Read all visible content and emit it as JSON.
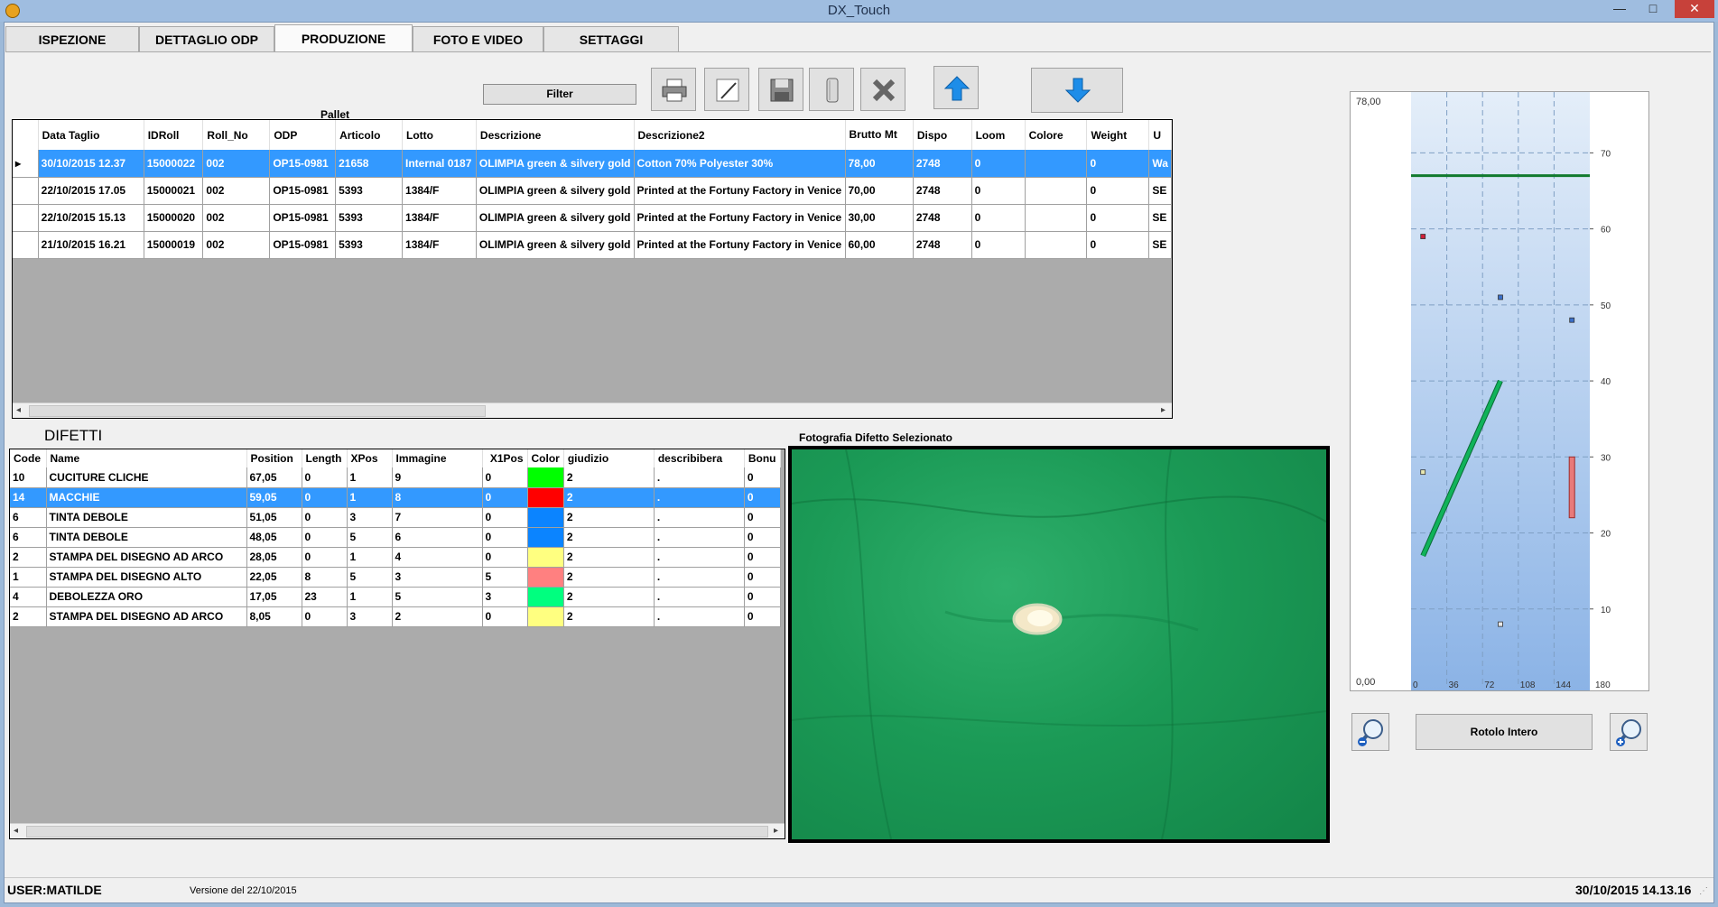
{
  "window": {
    "title": "DX_Touch",
    "close_glyph": "✕",
    "max_glyph": "□",
    "min_glyph": "—"
  },
  "tabs": [
    {
      "label": "ISPEZIONE"
    },
    {
      "label": "DETTAGLIO ODP"
    },
    {
      "label": "PRODUZIONE",
      "active": true
    },
    {
      "label": "FOTO E VIDEO"
    },
    {
      "label": "SETTAGGI"
    }
  ],
  "toolbar": {
    "filter_label": "Filter",
    "icons": [
      "printer-icon",
      "edit-icon",
      "save-icon",
      "roll-icon",
      "delete-icon",
      "arrow-up-icon",
      "arrow-down-icon"
    ]
  },
  "rolls": {
    "group_header": "Pallet",
    "columns": [
      "Data Taglio",
      "IDRoll",
      "Roll_No",
      "ODP",
      "Articolo",
      "Lotto",
      "Descrizione",
      "Descrizione2",
      "Brutto Mt",
      "Dispo",
      "Loom",
      "Colore",
      "Weight",
      "U"
    ],
    "rows": [
      [
        "30/10/2015 12.37",
        "15000022",
        "002",
        "OP15-0981",
        "21658",
        "Internal 0187",
        "OLIMPIA green & silvery gold",
        "Cotton 70% Polyester 30%",
        "78,00",
        "2748",
        "0",
        "",
        "0",
        "Wa"
      ],
      [
        "22/10/2015 17.05",
        "15000021",
        "002",
        "OP15-0981",
        "5393",
        "1384/F",
        "OLIMPIA green & silvery gold",
        "Printed at the Fortuny Factory in Venice",
        "70,00",
        "2748",
        "0",
        "",
        "0",
        "SE"
      ],
      [
        "22/10/2015 15.13",
        "15000020",
        "002",
        "OP15-0981",
        "5393",
        "1384/F",
        "OLIMPIA green & silvery gold",
        "Printed at the Fortuny Factory in Venice",
        "30,00",
        "2748",
        "0",
        "",
        "0",
        "SE"
      ],
      [
        "21/10/2015 16.21",
        "15000019",
        "002",
        "OP15-0981",
        "5393",
        "1384/F",
        "OLIMPIA green & silvery gold",
        "Printed at the Fortuny Factory in Venice",
        "60,00",
        "2748",
        "0",
        "",
        "0",
        "SE"
      ]
    ],
    "selected_index": 0,
    "row_marker": "▸"
  },
  "defects": {
    "title": "DIFETTI",
    "columns": [
      "Code",
      "Name",
      "Position",
      "Length",
      "XPos",
      "Immagine",
      "X1Pos",
      "Color",
      "giudizio",
      "describibera",
      "Bonu"
    ],
    "rows": [
      [
        "10",
        "CUCITURE CLICHE",
        "67,05",
        "0",
        "1",
        "9",
        "0",
        "#00ff00",
        "2",
        ".",
        "0"
      ],
      [
        "14",
        "MACCHIE",
        "59,05",
        "0",
        "1",
        "8",
        "0",
        "#ff0000",
        "2",
        ".",
        "0"
      ],
      [
        "6",
        "TINTA DEBOLE",
        "51,05",
        "0",
        "3",
        "7",
        "0",
        "#0b84ff",
        "2",
        ".",
        "0"
      ],
      [
        "6",
        "TINTA DEBOLE",
        "48,05",
        "0",
        "5",
        "6",
        "0",
        "#0b84ff",
        "2",
        ".",
        "0"
      ],
      [
        "2",
        "STAMPA DEL DISEGNO AD ARCO",
        "28,05",
        "0",
        "1",
        "4",
        "0",
        "#ffff80",
        "2",
        ".",
        "0"
      ],
      [
        "1",
        "STAMPA DEL DISEGNO ALTO",
        "22,05",
        "8",
        "5",
        "3",
        "5",
        "#ff8080",
        "2",
        ".",
        "0"
      ],
      [
        "4",
        "DEBOLEZZA ORO",
        "17,05",
        "23",
        "1",
        "5",
        "3",
        "#00ff7f",
        "2",
        ".",
        "0"
      ],
      [
        "2",
        "STAMPA DEL DISEGNO AD ARCO",
        "8,05",
        "0",
        "3",
        "2",
        "0",
        "#ffff80",
        "2",
        ".",
        "0"
      ]
    ],
    "selected_index": 1
  },
  "photo": {
    "label": "Fotografia Difetto Selezionato"
  },
  "chart_data": {
    "type": "scatter",
    "ymax_label": "78,00",
    "ymin_label": "0,00",
    "x_ticks": [
      "0",
      "36",
      "72",
      "108",
      "144",
      "180"
    ],
    "y_ticks": [
      "10",
      "20",
      "30",
      "40",
      "50",
      "60",
      "70"
    ],
    "xlim": [
      0,
      180
    ],
    "ylim": [
      0,
      78
    ],
    "cut_line_y": 67,
    "points": [
      {
        "x": 12,
        "y": 59,
        "color": "#d0203a"
      },
      {
        "x": 90,
        "y": 51,
        "color": "#3a6fc9"
      },
      {
        "x": 162,
        "y": 48,
        "color": "#3a6fc9"
      },
      {
        "x": 12,
        "y": 28,
        "color": "#e8e8b0"
      },
      {
        "x": 90,
        "y": 8,
        "color": "#e8e8e8"
      }
    ],
    "segments": [
      {
        "x1": 12,
        "y1": 17,
        "x2": 90,
        "y2": 40,
        "color": "#11b35a"
      }
    ],
    "bars": [
      {
        "x": 162,
        "y_from": 22,
        "y_to": 30,
        "color": "#e87a7a"
      }
    ]
  },
  "chart_controls": {
    "rotolo_label": "Rotolo Intero",
    "icons": [
      "zoom-out-icon",
      "zoom-in-icon"
    ]
  },
  "status": {
    "user": "USER:MATILDE",
    "version": "Versione del 22/10/2015",
    "datetime": "30/10/2015 14.13.16"
  }
}
